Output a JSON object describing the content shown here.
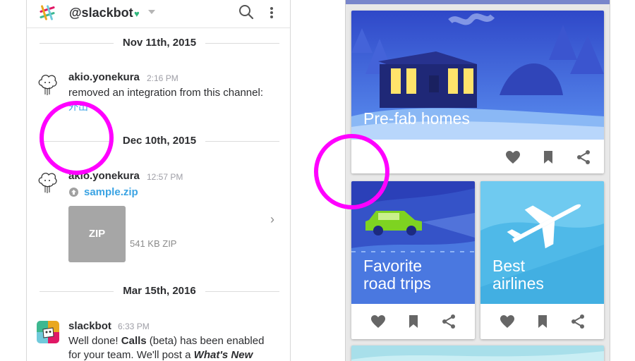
{
  "slack": {
    "channel": "@slackbot",
    "heart": "♥",
    "separators": [
      "Nov 11th, 2015",
      "Dec 10th, 2015",
      "Mar 15th, 2016"
    ],
    "messages": [
      {
        "author": "akio.yonekura",
        "time": "2:16 PM",
        "text": "removed an integration from this channel:",
        "link_fragment": "外出"
      },
      {
        "author": "akio.yonekura",
        "time": "12:57 PM",
        "file_name": "sample.zip",
        "file_type": "ZIP",
        "file_size": "541 KB ZIP"
      },
      {
        "author": "slackbot",
        "time": "6:33 PM",
        "line1_pre": "Well done! ",
        "line1_bold": "Calls",
        "line1_post": " (beta) has been enabled",
        "line2_pre": "for your team. We'll post a ",
        "line2_bold": "What's New"
      }
    ]
  },
  "cards": {
    "colors": {
      "accent": "#7886cb",
      "annotation": "#ff00ff"
    },
    "items": [
      {
        "title": "Pre-fab homes",
        "actions": [
          "heart-icon",
          "bookmark-icon",
          "share-icon"
        ]
      },
      {
        "title_line1": "Favorite",
        "title_line2": "road trips",
        "actions": [
          "heart-icon",
          "bookmark-icon",
          "share-icon"
        ]
      },
      {
        "title_line1": "Best",
        "title_line2": "airlines",
        "actions": [
          "heart-icon",
          "bookmark-icon",
          "share-icon"
        ]
      }
    ]
  }
}
